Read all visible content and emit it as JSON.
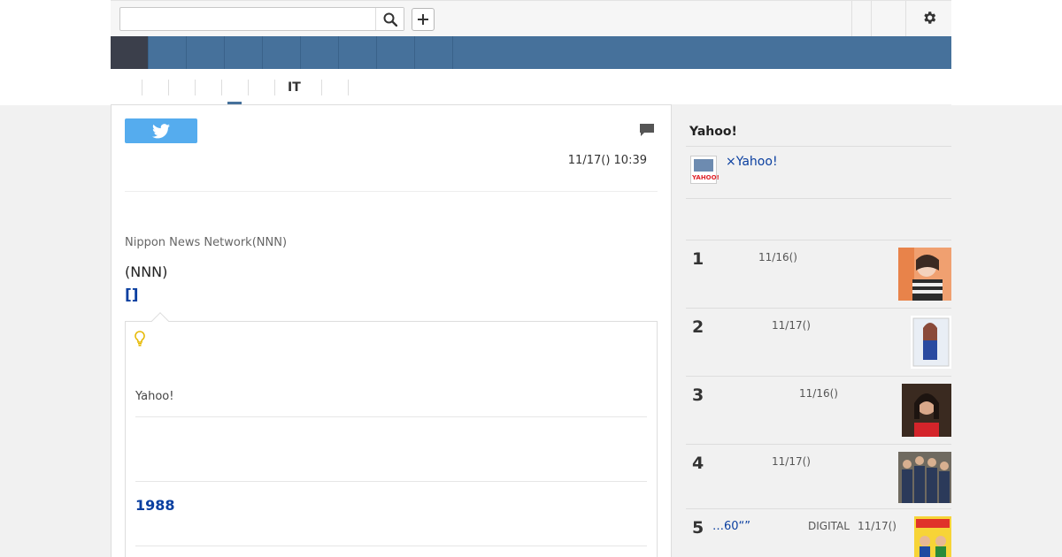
{
  "search": {
    "placeholder": "",
    "value": ""
  },
  "icons": {
    "search": "search-icon",
    "add": "plus-icon",
    "settings": "gear-icon",
    "twitter": "twitter-bird-icon",
    "comment": "comment-icon",
    "tip": "lightbulb-icon"
  },
  "colors": {
    "nav": "#46719b",
    "nav_active": "#3b3f4b",
    "link": "#0a3fa0",
    "tweet": "#55acee"
  },
  "subnav": {
    "it_tab": "IT"
  },
  "article": {
    "date": "11/17() 10:39",
    "source": "Nippon News Network(NNN)",
    "byline": "(NNN)",
    "bracket_link": "[]",
    "tip": {
      "yahoo_label": "Yahoo!",
      "year_link": "1988"
    }
  },
  "sidebar": {
    "title": "Yahoo!",
    "promo_link": "×Yahoo!",
    "logo_text": "YAHOO!",
    "ranking": [
      {
        "rank": "1",
        "date": "11/16()",
        "title": "",
        "source": ""
      },
      {
        "rank": "2",
        "date": "11/17()",
        "title": "",
        "source": ""
      },
      {
        "rank": "3",
        "date": "11/16()",
        "title": "",
        "source": ""
      },
      {
        "rank": "4",
        "date": "11/17()",
        "title": "",
        "source": ""
      },
      {
        "rank": "5",
        "date": "11/17()",
        "title": "…60“”",
        "source": "DIGITAL"
      }
    ]
  }
}
